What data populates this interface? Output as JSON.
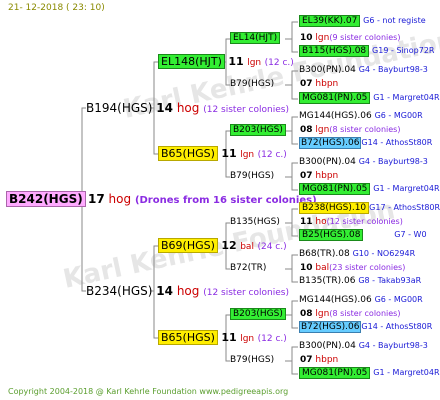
{
  "header": {
    "date": "21- 12-2018 ( 23: 10)"
  },
  "footer": {
    "copyright": "Copyright 2004-2018 @ Karl Kehrle Foundation    www.pedigreeapis.org"
  },
  "root": {
    "id": "B242(HGS)",
    "num": "17",
    "type": "hog",
    "note": "(Drones from 16 sister colonies)"
  },
  "g1": [
    {
      "id": "B194(HGS)",
      "num": "14",
      "type": "hog",
      "note": "(12 sister colonies)"
    },
    {
      "id": "B234(HGS)",
      "num": "14",
      "type": "hog",
      "note": "(12 sister colonies)"
    }
  ],
  "g2": [
    {
      "id": "EL148(HJT)",
      "num": "11",
      "type": "lgn",
      "note": "(12 c.)"
    },
    {
      "id": "B65(HGS)",
      "num": "11",
      "type": "lgn",
      "note": "(12 c.)"
    },
    {
      "id": "B69(HGS)",
      "num": "12",
      "type": "bal",
      "note": "(24 c.)"
    },
    {
      "id": "B65(HGS)",
      "num": "11",
      "type": "lgn",
      "note": "(12 c.)"
    }
  ],
  "g3": [
    {
      "id": "EL14(HJT)",
      "num": "10",
      "type": "lgn",
      "note": "(9 sister colonies)"
    },
    {
      "id": "B79(HGS)",
      "num": "07",
      "type": "hbpn",
      "note": ""
    },
    {
      "id": "B203(HGS)",
      "num": "08",
      "type": "lgn",
      "note": "(8 sister colonies)"
    },
    {
      "id": "B79(HGS)",
      "num": "07",
      "type": "hbpn",
      "note": ""
    },
    {
      "id": "B135(HGS)",
      "num": "11",
      "type": "ho",
      "note": "(12 sister colonies)"
    },
    {
      "id": "B72(TR)",
      "num": "10",
      "type": "bal",
      "note": "(23 sister colonies)"
    },
    {
      "id": "B203(HGS)",
      "num": "08",
      "type": "lgn",
      "note": "(8 sister colonies)"
    },
    {
      "id": "B79(HGS)",
      "num": "07",
      "type": "hbpn",
      "note": ""
    }
  ],
  "g4": [
    {
      "id": "EL39(KK).07",
      "loc": "G6 - not registe"
    },
    {
      "id": "B115(HGS).08",
      "loc": "G19 - Sinop72R"
    },
    {
      "id": "B300(PN).04",
      "loc": "G4 - Bayburt98-3"
    },
    {
      "id": "MG081(PN).05",
      "loc": "G1 - Margret04R"
    },
    {
      "id": "MG144(HGS).06",
      "loc": "G6 - MG00R"
    },
    {
      "id": "B72(HGS).06",
      "loc": "G14 - AthosSt80R"
    },
    {
      "id": "B300(PN).04",
      "loc": "G4 - Bayburt98-3"
    },
    {
      "id": "MG081(PN).05",
      "loc": "G1 - Margret04R"
    },
    {
      "id": "B238(HGS).10",
      "loc": "G17 - AthosSt80R"
    },
    {
      "id": "B25(HGS).08",
      "loc": "G7 - W0"
    },
    {
      "id": "B68(TR).08",
      "loc": "G10 - NO6294R"
    },
    {
      "id": "B135(TR).06",
      "loc": "G8 - Takab93aR"
    },
    {
      "id": "MG144(HGS).06",
      "loc": "G6 - MG00R"
    },
    {
      "id": "B72(HGS).06",
      "loc": "G14 - AthosSt80R"
    },
    {
      "id": "B300(PN).04",
      "loc": "G4 - Bayburt98-3"
    },
    {
      "id": "MG081(PN).05",
      "loc": "G1 - Margret04R"
    }
  ]
}
